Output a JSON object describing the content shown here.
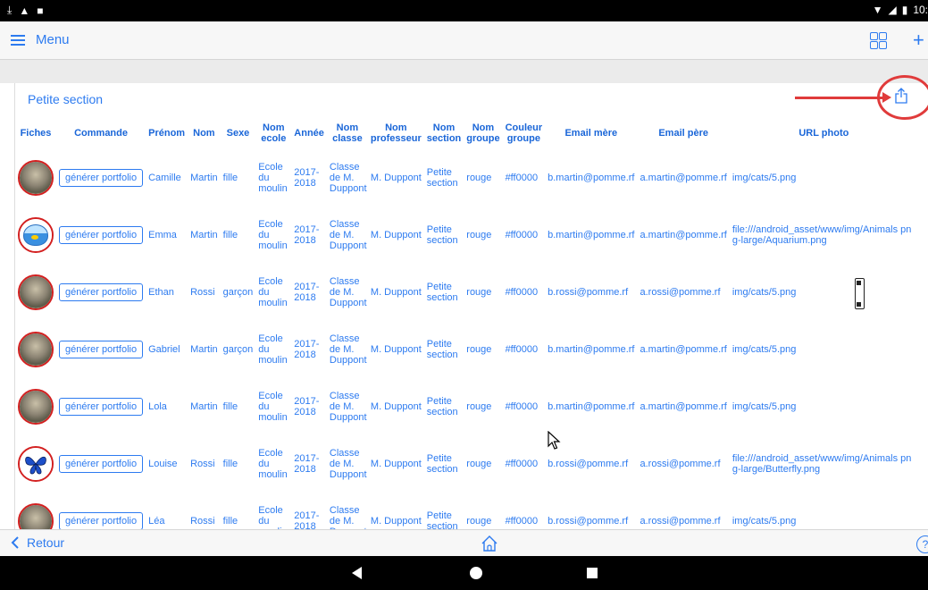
{
  "statusbar": {
    "time": "10:"
  },
  "appbar": {
    "menu_label": "Menu"
  },
  "section": {
    "title": "Petite section"
  },
  "table": {
    "headers": [
      "Fiches",
      "Commande",
      "Prénom",
      "Nom",
      "Sexe",
      "Nom\necole",
      "Année",
      "Nom\nclasse",
      "Nom\nprofesseur",
      "Nom\nsection",
      "Nom\ngroupe",
      "Couleur\ngroupe",
      "Email mère",
      "Email père",
      "URL photo"
    ],
    "rows": [
      {
        "avatar": "cat",
        "button": "générer portfolio",
        "prenom": "Camille",
        "nom": "Martin",
        "sexe": "fille",
        "ecole": "Ecole du moulin",
        "annee": "2017-2018",
        "classe": "Classe de M. Duppont",
        "professeur": "M. Duppont",
        "section": "Petite section",
        "groupe": "rouge",
        "couleur": "#ff0000",
        "email_mere": "b.martin@pomme.rf",
        "email_pere": "a.martin@pomme.rf",
        "url": "img/cats/5.png"
      },
      {
        "avatar": "aquarium",
        "button": "générer portfolio",
        "prenom": "Emma",
        "nom": "Martin",
        "sexe": "fille",
        "ecole": "Ecole du moulin",
        "annee": "2017-2018",
        "classe": "Classe de M. Duppont",
        "professeur": "M. Duppont",
        "section": "Petite section",
        "groupe": "rouge",
        "couleur": "#ff0000",
        "email_mere": "b.martin@pomme.rf",
        "email_pere": "a.martin@pomme.rf",
        "url": "file:///android_asset/www/img/Animals png-large/Aquarium.png"
      },
      {
        "avatar": "cat",
        "button": "générer portfolio",
        "prenom": "Ethan",
        "nom": "Rossi",
        "sexe": "garçon",
        "ecole": "Ecole du moulin",
        "annee": "2017-2018",
        "classe": "Classe de M. Duppont",
        "professeur": "M. Duppont",
        "section": "Petite section",
        "groupe": "rouge",
        "couleur": "#ff0000",
        "email_mere": "b.rossi@pomme.rf",
        "email_pere": "a.rossi@pomme.rf",
        "url": "img/cats/5.png"
      },
      {
        "avatar": "cat",
        "button": "générer portfolio",
        "prenom": "Gabriel",
        "nom": "Martin",
        "sexe": "garçon",
        "ecole": "Ecole du moulin",
        "annee": "2017-2018",
        "classe": "Classe de M. Duppont",
        "professeur": "M. Duppont",
        "section": "Petite section",
        "groupe": "rouge",
        "couleur": "#ff0000",
        "email_mere": "b.martin@pomme.rf",
        "email_pere": "a.martin@pomme.rf",
        "url": "img/cats/5.png"
      },
      {
        "avatar": "cat",
        "button": "générer portfolio",
        "prenom": "Lola",
        "nom": "Martin",
        "sexe": "fille",
        "ecole": "Ecole du moulin",
        "annee": "2017-2018",
        "classe": "Classe de M. Duppont",
        "professeur": "M. Duppont",
        "section": "Petite section",
        "groupe": "rouge",
        "couleur": "#ff0000",
        "email_mere": "b.martin@pomme.rf",
        "email_pere": "a.martin@pomme.rf",
        "url": "img/cats/5.png"
      },
      {
        "avatar": "butterfly",
        "button": "générer portfolio",
        "prenom": "Louise",
        "nom": "Rossi",
        "sexe": "fille",
        "ecole": "Ecole du moulin",
        "annee": "2017-2018",
        "classe": "Classe de M. Duppont",
        "professeur": "M. Duppont",
        "section": "Petite section",
        "groupe": "rouge",
        "couleur": "#ff0000",
        "email_mere": "b.rossi@pomme.rf",
        "email_pere": "a.rossi@pomme.rf",
        "url": "file:///android_asset/www/img/Animals png-large/Butterfly.png"
      },
      {
        "avatar": "cat",
        "button": "générer portfolio",
        "prenom": "Léa",
        "nom": "Rossi",
        "sexe": "fille",
        "ecole": "Ecole du moulin",
        "annee": "2017-2018",
        "classe": "Classe de M. Duppont",
        "professeur": "M. Duppont",
        "section": "Petite section",
        "groupe": "rouge",
        "couleur": "#ff0000",
        "email_mere": "b.rossi@pomme.rf",
        "email_pere": "a.rossi@pomme.rf",
        "url": "img/cats/5.png"
      }
    ]
  },
  "bottombar": {
    "back_label": "Retour",
    "help_label": "?"
  },
  "colors": {
    "accent": "#2d7bf0",
    "annotation": "#e03b3b"
  },
  "icons": [
    "download-icon",
    "alert-icon",
    "sd-card-icon",
    "wifi-icon",
    "signal-icon",
    "battery-icon",
    "hamburger-icon",
    "grid-icon",
    "plus-icon",
    "share-icon",
    "home-icon",
    "help-icon"
  ]
}
